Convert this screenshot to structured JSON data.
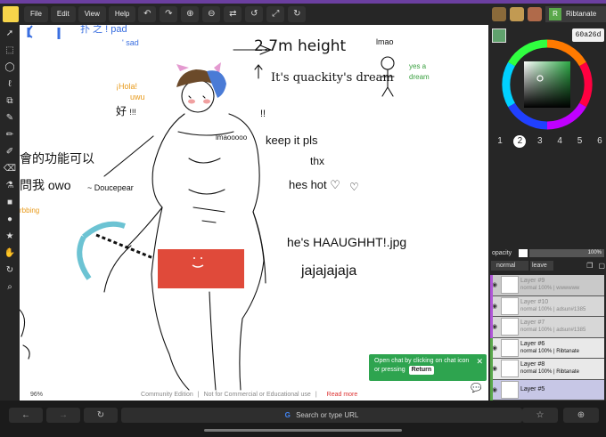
{
  "menubar": {
    "items": [
      "File",
      "Edit",
      "View",
      "Help"
    ],
    "tools": [
      "↶",
      "↷",
      "⊕",
      "⊖",
      "⇄",
      "↺",
      "⤢",
      "↻"
    ]
  },
  "user": {
    "initial": "R",
    "name": "Ribtanate"
  },
  "color": {
    "hex": "60a26d",
    "primary": "#60a26d",
    "secondary": "#c8b23c"
  },
  "brushes": [
    "1",
    "2",
    "3",
    "4",
    "5",
    "6"
  ],
  "opacity": {
    "label": "opacity",
    "value": "100%",
    "level": 1.0
  },
  "blend": {
    "mode": "normal",
    "leave_label": "leave"
  },
  "layers": [
    {
      "name": "Layer #9",
      "sub": "normal 100% | wwwwww",
      "style": "faded",
      "mark": "#b056d8"
    },
    {
      "name": "Layer #10",
      "sub": "normal 100% | adsun#1385",
      "style": "faded2",
      "mark": "#b056d8"
    },
    {
      "name": "Layer #7",
      "sub": "normal 100% | adsun#1385",
      "style": "faded2",
      "mark": "#b056d8"
    },
    {
      "name": "Layer #6",
      "sub": "normal 100% | Ribtanate",
      "style": "solid",
      "mark": "#5aa84b"
    },
    {
      "name": "Layer #8",
      "sub": "normal 100% | Ribtanate",
      "style": "solid",
      "mark": "#5aa84b"
    },
    {
      "name": "Layer #5",
      "sub": "",
      "style": "active",
      "mark": "#5aa84b"
    }
  ],
  "canvas": {
    "texts": {
      "pad": "pad",
      "sad": "' sad",
      "height": "2.7m height",
      "lmao": "lmao",
      "dream_sub": "It's quackity's dream",
      "yesadream1": "yes a",
      "yesadream2": "dream",
      "hola": "¡Hola!",
      "uwu": "uwu",
      "exclaim": "!!!",
      "exclaim2": "!!",
      "lmaooooo": "lmaooooo",
      "keepit": "keep it pls",
      "thx": "thx",
      "hot": "hes hot ♡",
      "cn1": "會的功能可以",
      "cn2": "問我 owo",
      "doucepear": "~ Doucepear",
      "bbing": "rbbing",
      "haaugh": "he's HAAUGHHT!.jpg",
      "jaja": "jajajajaja"
    },
    "status": {
      "zoom": "96%",
      "edition": "Community Edition",
      "license": "Not for Commercial or Educational use",
      "readmore": "Read more"
    },
    "toast": {
      "text": "Open chat by clicking on chat icon or pressing",
      "key": "Return",
      "close": "✕"
    }
  },
  "browser": {
    "url_placeholder": "Search or type URL",
    "g": "G"
  }
}
